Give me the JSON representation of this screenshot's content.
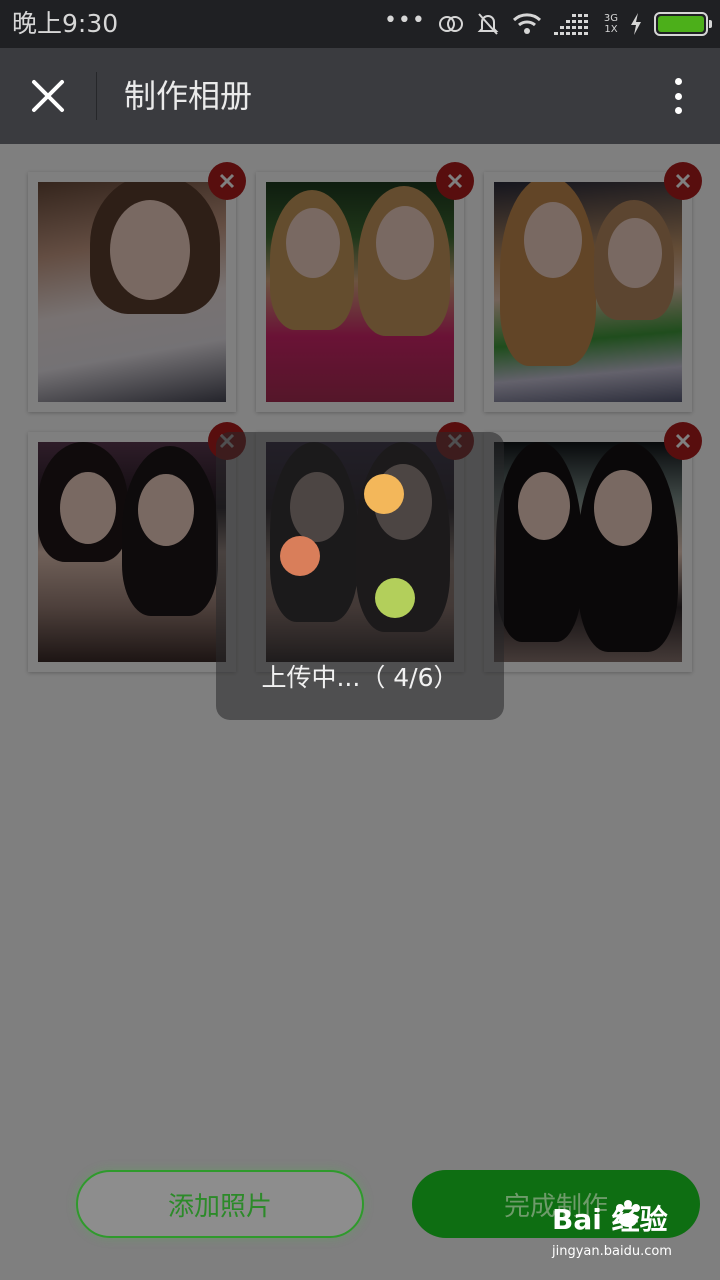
{
  "status_bar": {
    "time": "晚上9:30",
    "dots": "•••",
    "network_type": "3G",
    "network_rate": "1X",
    "battery_color": "#4caf1a"
  },
  "header": {
    "title": "制作相册",
    "close_icon": "close-icon",
    "more_icon": "more-vertical-icon"
  },
  "photos": [
    {
      "icon": "photo-1"
    },
    {
      "icon": "photo-2"
    },
    {
      "icon": "photo-3"
    },
    {
      "icon": "photo-4"
    },
    {
      "icon": "photo-5"
    },
    {
      "icon": "photo-6"
    }
  ],
  "loading": {
    "text": "上传中...（ 4/6）",
    "dot_colors": [
      "#f3b75a",
      "#d97e5a",
      "#b3cf5b"
    ]
  },
  "buttons": {
    "add_label": "添加照片",
    "done_label": "完成制作"
  },
  "watermark": {
    "logo_text": "Bai  经验",
    "url": "jingyan.baidu.com"
  },
  "colors": {
    "accent_green": "#0e6e12",
    "delete_red": "#b01c1c",
    "title_bar": "#3a3b3f"
  }
}
